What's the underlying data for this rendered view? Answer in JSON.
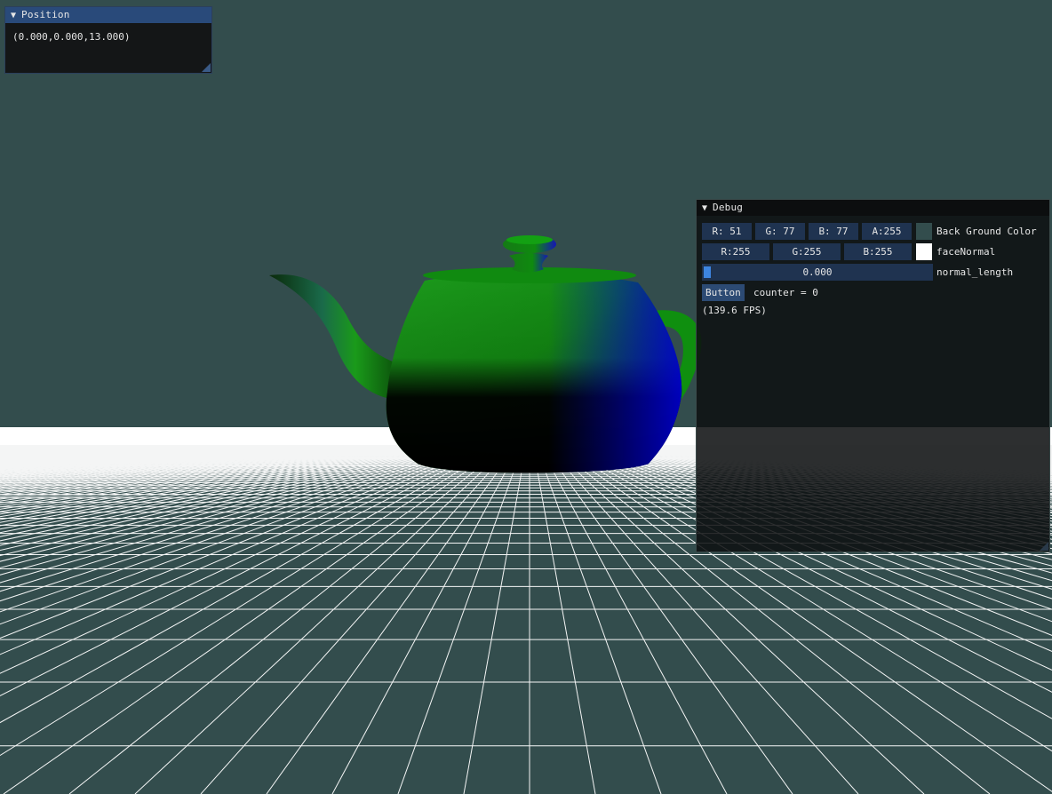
{
  "colors": {
    "background": "#334d4d",
    "grid_line": "#ffffff",
    "teapot_green": "#1f9c1f",
    "teapot_blue": "#1414c8"
  },
  "position_window": {
    "title": "Position",
    "collapse_icon": "triangle-down",
    "value": "(0.000,0.000,13.000)"
  },
  "debug_window": {
    "title": "Debug",
    "collapse_icon": "triangle-down",
    "bg_color": {
      "r": "R: 51",
      "g": "G: 77",
      "b": "B: 77",
      "a": "A:255",
      "swatch": "#334d4d",
      "label": "Back Ground Color"
    },
    "face_normal": {
      "r": "R:255",
      "g": "G:255",
      "b": "B:255",
      "swatch": "#ffffff",
      "label": "faceNormal"
    },
    "normal_length": {
      "value": "0.000",
      "label": "normal_length",
      "fraction": 0.0
    },
    "button_label": "Button",
    "counter_text": "counter = 0",
    "fps_text": "(139.6 FPS)"
  }
}
